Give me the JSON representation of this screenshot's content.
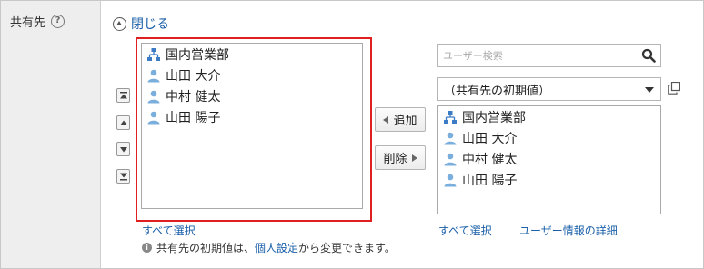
{
  "field": {
    "label": "共有先",
    "help_icon": "question-circle-icon"
  },
  "close_link": {
    "label": "閉じる",
    "icon": "circle-up-arrow-icon"
  },
  "order_buttons": [
    "move-to-top-icon",
    "move-up-icon",
    "move-down-icon",
    "move-to-bottom-icon"
  ],
  "left_list": {
    "items": [
      {
        "label": "国内営業部",
        "type": "organization",
        "icon": "org-icon"
      },
      {
        "label": "山田 大介",
        "type": "user",
        "icon": "user-icon"
      },
      {
        "label": "中村 健太",
        "type": "user",
        "icon": "user-icon"
      },
      {
        "label": "山田 陽子",
        "type": "user",
        "icon": "user-icon"
      }
    ],
    "select_all": "すべて選択",
    "highlight_color": "#e02020"
  },
  "buttons": {
    "add": "追加",
    "remove": "削除"
  },
  "search": {
    "placeholder": "ユーザー検索",
    "icon": "search-icon"
  },
  "dropdown": {
    "selected": "（共有先の初期値）"
  },
  "right_list": {
    "items": [
      {
        "label": "国内営業部",
        "type": "organization",
        "icon": "org-icon"
      },
      {
        "label": "山田 大介",
        "type": "user",
        "icon": "user-icon"
      },
      {
        "label": "中村 健太",
        "type": "user",
        "icon": "user-icon"
      },
      {
        "label": "山田 陽子",
        "type": "user",
        "icon": "user-icon"
      }
    ],
    "select_all": "すべて選択",
    "user_detail_link": "ユーザー情報の詳細"
  },
  "note": {
    "prefix": "共有先の初期値は、",
    "link": "個人設定",
    "suffix": "から変更できます。"
  },
  "colors": {
    "link": "#1a5fa8",
    "user_icon": "#7aaedc",
    "org_icon": "#3b7cc4"
  }
}
